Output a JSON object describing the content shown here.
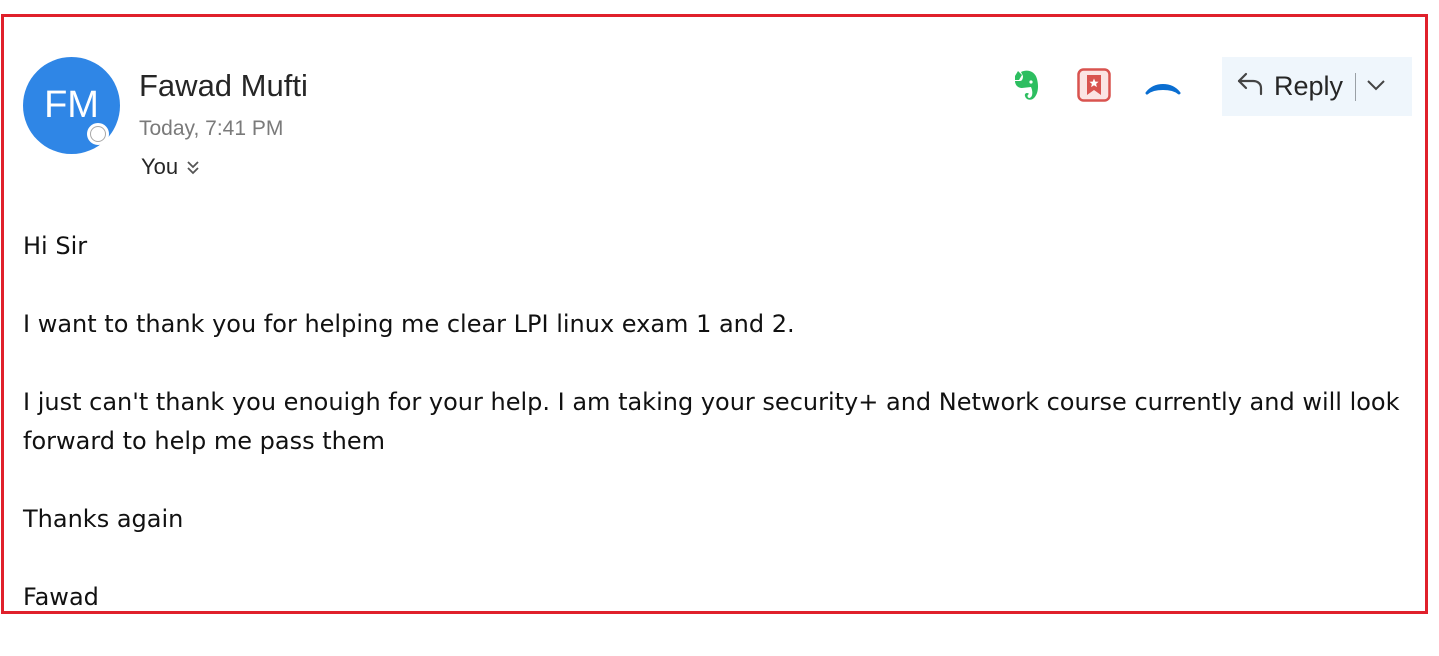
{
  "message": {
    "sender": {
      "initials": "FM",
      "name": "Fawad Mufti",
      "time": "Today, 7:41 PM"
    },
    "recipient": {
      "label": "You"
    },
    "toolbar": {
      "icons": [
        "evernote-icon",
        "bookmark-star-icon",
        "collapse-chevron-icon"
      ],
      "reply_label": "Reply"
    },
    "body": {
      "greeting": "Hi Sir",
      "para1": "I want to thank you for helping me clear LPI linux exam 1 and 2.",
      "para2": "I just can't thank you enouigh for your help. I am taking your security+ and Network course currently and will look forward to help me pass them",
      "closing": "Thanks again",
      "signature": "Fawad"
    },
    "colors": {
      "frame": "#e0202b",
      "avatar": "#2f86e6",
      "evernote": "#2dbe60",
      "bookmark": "#d9534f",
      "accent": "#0a6ed1",
      "reply_bg": "#eff6fc"
    }
  }
}
